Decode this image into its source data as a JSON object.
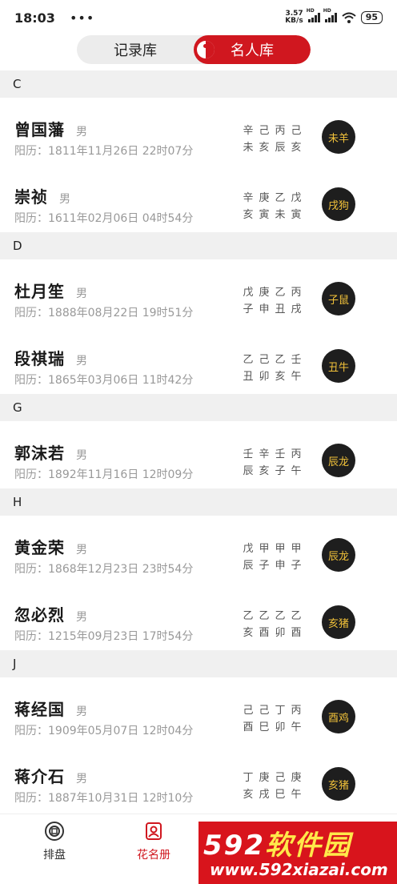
{
  "status": {
    "time": "18:03",
    "dots": "•••",
    "net_speed_value": "3.57",
    "net_speed_unit": "KB/s",
    "signal_label": "HD",
    "battery": "95"
  },
  "segment": {
    "tabs": [
      {
        "label": "记录库",
        "active": false
      },
      {
        "label": "名人库",
        "active": true
      }
    ]
  },
  "sections": [
    {
      "letter": "C",
      "items": [
        {
          "name": "曾国藩",
          "gender": "男",
          "date": "阳历：1811年11月26日 22时07分",
          "bazi_stems": [
            "辛",
            "己",
            "丙",
            "己"
          ],
          "bazi_branches": [
            "未",
            "亥",
            "辰",
            "亥"
          ],
          "zodiac": "未羊"
        },
        {
          "name": "崇祯",
          "gender": "男",
          "date": "阳历：1611年02月06日 04时54分",
          "bazi_stems": [
            "辛",
            "庚",
            "乙",
            "戊"
          ],
          "bazi_branches": [
            "亥",
            "寅",
            "未",
            "寅"
          ],
          "zodiac": "戌狗"
        }
      ]
    },
    {
      "letter": "D",
      "items": [
        {
          "name": "杜月笙",
          "gender": "男",
          "date": "阳历：1888年08月22日 19时51分",
          "bazi_stems": [
            "戊",
            "庚",
            "乙",
            "丙"
          ],
          "bazi_branches": [
            "子",
            "申",
            "丑",
            "戌"
          ],
          "zodiac": "子鼠"
        },
        {
          "name": "段祺瑞",
          "gender": "男",
          "date": "阳历：1865年03月06日 11时42分",
          "bazi_stems": [
            "乙",
            "己",
            "乙",
            "壬"
          ],
          "bazi_branches": [
            "丑",
            "卯",
            "亥",
            "午"
          ],
          "zodiac": "丑牛"
        }
      ]
    },
    {
      "letter": "G",
      "items": [
        {
          "name": "郭沫若",
          "gender": "男",
          "date": "阳历：1892年11月16日 12时09分",
          "bazi_stems": [
            "壬",
            "辛",
            "壬",
            "丙"
          ],
          "bazi_branches": [
            "辰",
            "亥",
            "子",
            "午"
          ],
          "zodiac": "辰龙"
        }
      ]
    },
    {
      "letter": "H",
      "items": [
        {
          "name": "黄金荣",
          "gender": "男",
          "date": "阳历：1868年12月23日 23时54分",
          "bazi_stems": [
            "戊",
            "甲",
            "甲",
            "甲"
          ],
          "bazi_branches": [
            "辰",
            "子",
            "申",
            "子"
          ],
          "zodiac": "辰龙"
        },
        {
          "name": "忽必烈",
          "gender": "男",
          "date": "阳历：1215年09月23日 17时54分",
          "bazi_stems": [
            "乙",
            "乙",
            "乙",
            "乙"
          ],
          "bazi_branches": [
            "亥",
            "酉",
            "卯",
            "酉"
          ],
          "zodiac": "亥猪"
        }
      ]
    },
    {
      "letter": "J",
      "items": [
        {
          "name": "蒋经国",
          "gender": "男",
          "date": "阳历：1909年05月07日 12时04分",
          "bazi_stems": [
            "己",
            "己",
            "丁",
            "丙"
          ],
          "bazi_branches": [
            "酉",
            "巳",
            "卯",
            "午"
          ],
          "zodiac": "酉鸡"
        },
        {
          "name": "蒋介石",
          "gender": "男",
          "date": "阳历：1887年10月31日 12时10分",
          "bazi_stems": [
            "丁",
            "庚",
            "己",
            "庚"
          ],
          "bazi_branches": [
            "亥",
            "戌",
            "巳",
            "午"
          ],
          "zodiac": "亥猪"
        }
      ]
    }
  ],
  "tabbar": {
    "items": [
      {
        "label": "排盘",
        "icon": "compass-icon"
      },
      {
        "label": "花名册",
        "icon": "roster-icon"
      }
    ]
  },
  "watermark": {
    "number": "592",
    "brand": "软件园",
    "url": "www.592xiazai.com"
  },
  "colors": {
    "accent": "#d0171f",
    "zodiac_bg": "#1e1e1e",
    "zodiac_text": "#f2c23a",
    "section_bg": "#f0f0f0"
  }
}
